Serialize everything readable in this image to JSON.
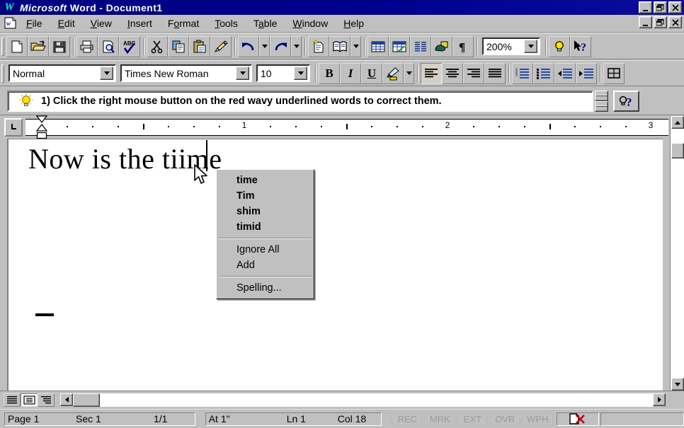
{
  "window": {
    "app_title_bold": "Microsoft",
    "app_title_rest": "Word - Document1",
    "logo_letter": "W",
    "buttons": {
      "minimize": "minimize-button",
      "restore": "restore-button",
      "close": "close-button"
    }
  },
  "menubar": {
    "items": [
      {
        "label": "File",
        "accel": "F"
      },
      {
        "label": "Edit",
        "accel": "E"
      },
      {
        "label": "View",
        "accel": "V"
      },
      {
        "label": "Insert",
        "accel": "I"
      },
      {
        "label": "Format",
        "accel": "o"
      },
      {
        "label": "Tools",
        "accel": "T"
      },
      {
        "label": "Table",
        "accel": "a"
      },
      {
        "label": "Window",
        "accel": "W"
      },
      {
        "label": "Help",
        "accel": "H"
      }
    ]
  },
  "standard_toolbar": {
    "buttons": [
      "new-document-icon",
      "open-folder-icon",
      "save-icon",
      "print-icon",
      "print-preview-icon",
      "spelling-check-icon",
      "cut-scissors-icon",
      "copy-icon",
      "paste-clipboard-icon",
      "format-painter-icon",
      "undo-icon",
      "undo-dropdown-icon",
      "redo-icon",
      "redo-dropdown-icon",
      "autoformat-icon",
      "insert-address-book-icon",
      "address-dropdown-icon",
      "insert-table-icon",
      "insert-excel-worksheet-icon",
      "columns-icon",
      "drawing-icon",
      "show-paragraph-marks-icon",
      "tip-wizard-icon",
      "help-pointer-icon"
    ],
    "zoom_value": "200%"
  },
  "formatting_toolbar": {
    "style_value": "Normal",
    "font_value": "Times New Roman",
    "size_value": "10",
    "bold_label": "B",
    "italic_label": "I",
    "underline_label": "U",
    "buttons": [
      "highlight-icon",
      "highlight-dropdown-icon",
      "align-left-icon",
      "align-center-icon",
      "align-right-icon",
      "justify-icon",
      "numbered-list-icon",
      "bulleted-list-icon",
      "decrease-indent-icon",
      "increase-indent-icon",
      "borders-icon"
    ]
  },
  "tip_bar": {
    "icon": "lightbulb-icon",
    "text": "1) Click the right mouse button on the red wavy underlined words to correct them.",
    "help_icon": "tipwizard-help-icon"
  },
  "ruler": {
    "tab_selector": "left-tab-stop-icon",
    "numbers": [
      "1",
      "2",
      "3"
    ],
    "unit": "inches"
  },
  "document": {
    "text_before": "Now is the ",
    "misspelled_word": "tiime",
    "misspell_underline_color": "#e01b1b",
    "caret": "text-caret",
    "cursor": "mouse-pointer"
  },
  "context_menu": {
    "suggestions": [
      "time",
      "Tim",
      "shim",
      "timid"
    ],
    "actions": [
      "Ignore All",
      "Add"
    ],
    "more": [
      "Spelling..."
    ]
  },
  "view_buttons": [
    "normal-view-icon",
    "page-layout-view-icon",
    "outline-view-icon"
  ],
  "status_bar": {
    "page_label": "Page 1",
    "section_label": "Sec 1",
    "pages_label": "1/1",
    "at_label": "At 1\"",
    "line_label": "Ln 1",
    "column_label": "Col 18",
    "flags": [
      "REC",
      "MRK",
      "EXT",
      "OVR",
      "WPH"
    ],
    "spell_icon": "spell-check-status-icon"
  },
  "colors": {
    "titlebar": "#00007e",
    "face": "#c0c0c0",
    "shadow": "#808080",
    "highlight": "#ffffff",
    "accent_blue": "#000080",
    "accent_yellow": "#ffe000",
    "error_red": "#e01b1b"
  }
}
